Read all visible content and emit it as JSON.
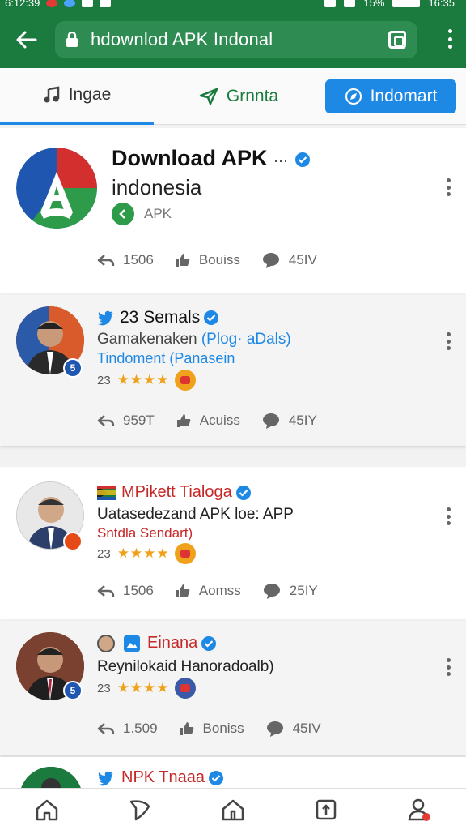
{
  "status_bar": {
    "time_left": "6:12:39",
    "battery": "15%",
    "time_right": "16:35"
  },
  "browser": {
    "url": "hdownlod APK Indonal"
  },
  "tabs": [
    {
      "label": "Ingae"
    },
    {
      "label": "Grnnta"
    },
    {
      "label": "Indomart"
    }
  ],
  "header_card": {
    "title": "Download APK",
    "title_suffix": "···",
    "subtitle": "indonesia",
    "tag": "APK",
    "shares": "1506",
    "likes": "Bouiss",
    "comments": "45IV"
  },
  "posts": [
    {
      "name": "23 Semals",
      "line1": "Gamakenaken",
      "line1_extra": "(Plog· aDals)",
      "line2": "Tindoment (Panasein",
      "badge": "5",
      "rating": "23",
      "stars": "★★★★",
      "shares": "959T",
      "likes": "Acuiss",
      "comments": "45IY"
    },
    {
      "name": "MPikett Tialoga",
      "line1": "Uatasedezand APK loe: APP",
      "line2": "Sntdla Sendart)",
      "rating": "23",
      "stars": "★★★★",
      "shares": "1506",
      "likes": "Aomss",
      "comments": "25IY"
    },
    {
      "name": "Einana",
      "line1": "Reynilokaid Hanoradoalb)",
      "badge": "5",
      "rating": "23",
      "stars": "★★★★",
      "shares": "1.509",
      "likes": "Boniss",
      "comments": "45IV"
    },
    {
      "name": "NPK Tnaaa"
    }
  ],
  "colors": {
    "brand_green": "#1b7a3e",
    "accent_blue": "#1e88e5",
    "star": "#f0a11b",
    "name_red": "#c62828"
  }
}
